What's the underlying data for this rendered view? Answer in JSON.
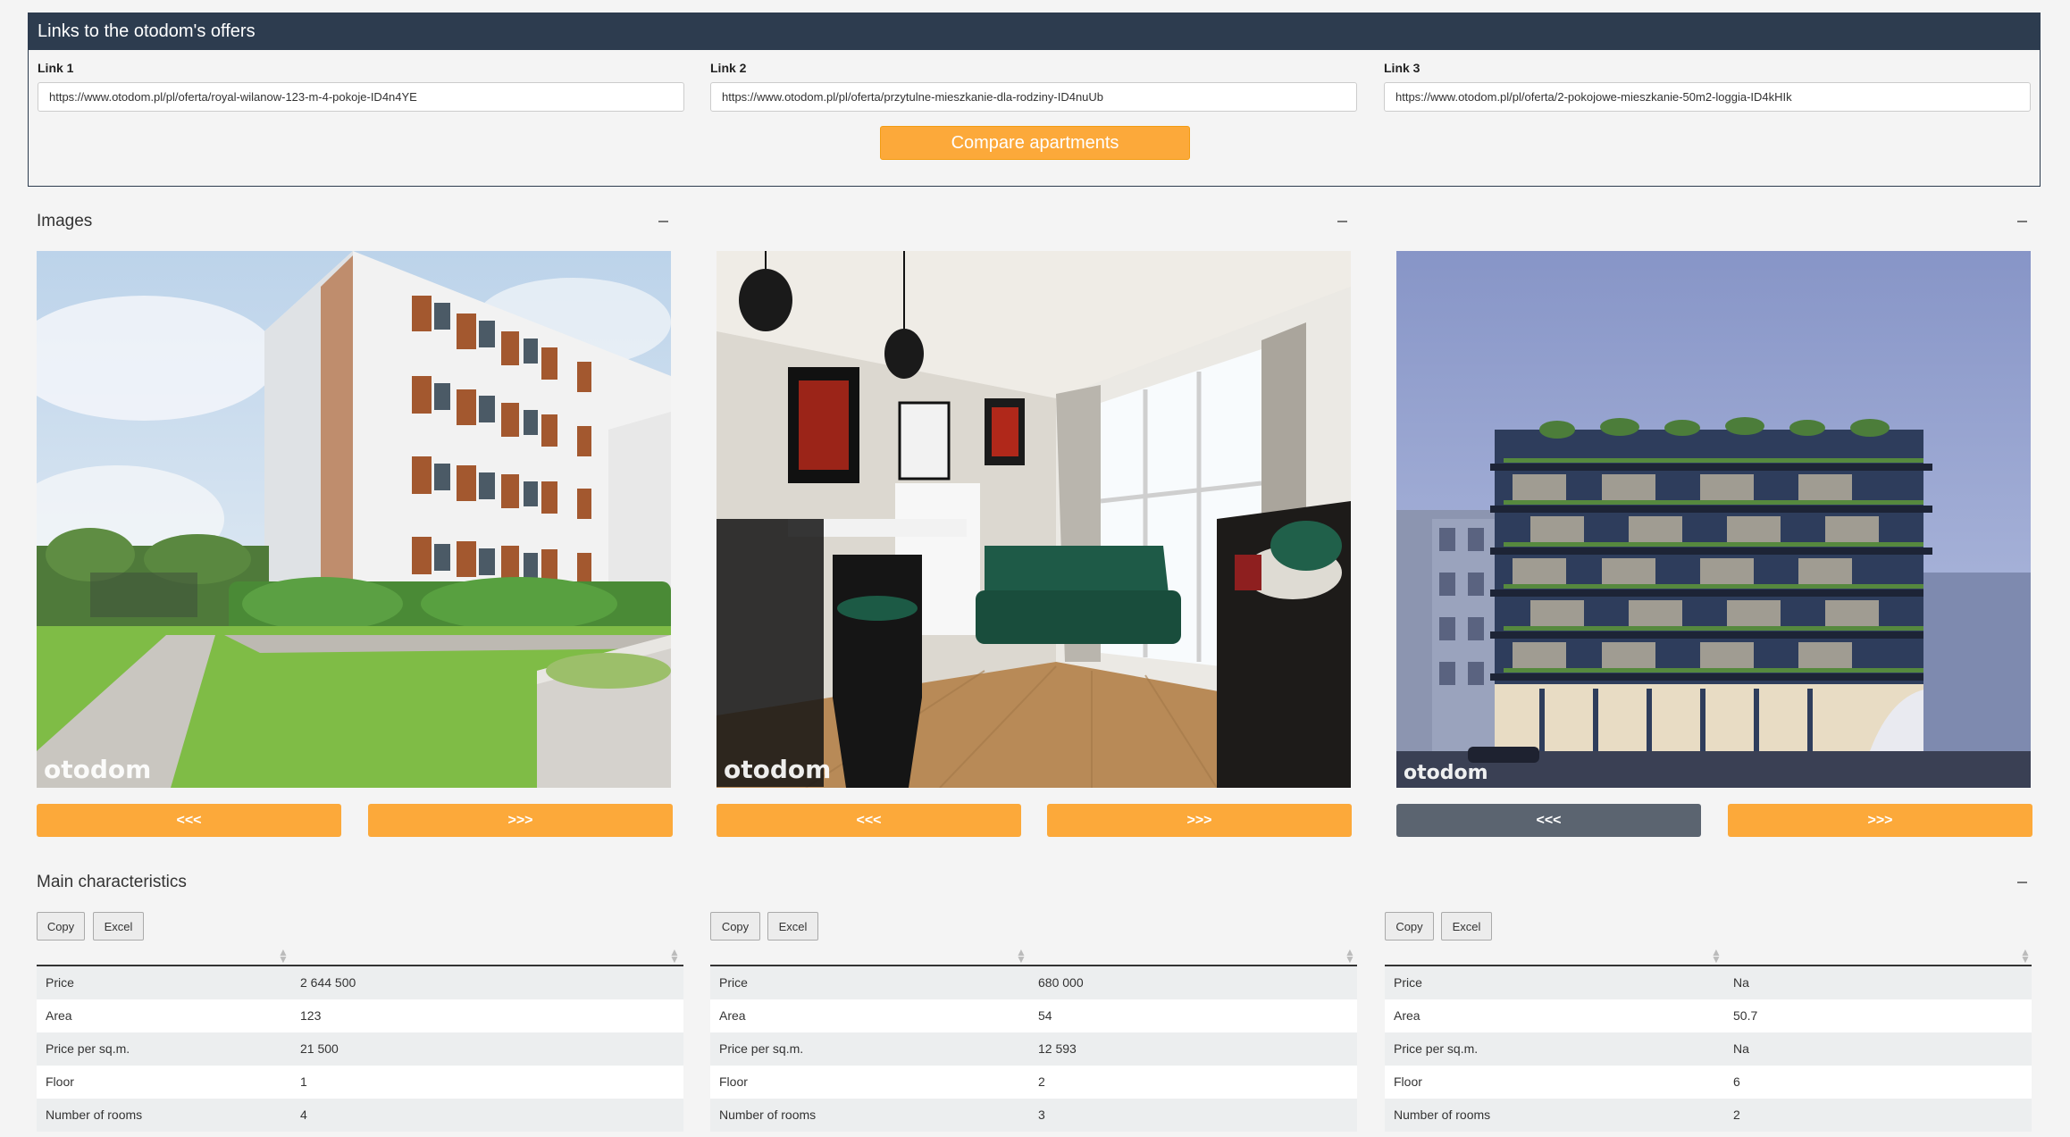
{
  "links_box": {
    "title": "Links to the otodom's offers",
    "links": [
      {
        "label": "Link 1",
        "value": "https://www.otodom.pl/pl/oferta/royal-wilanow-123-m-4-pokoje-ID4n4YE"
      },
      {
        "label": "Link 2",
        "value": "https://www.otodom.pl/pl/oferta/przytulne-mieszkanie-dla-rodziny-ID4nuUb"
      },
      {
        "label": "Link 3",
        "value": "https://www.otodom.pl/pl/oferta/2-pokojowe-mieszkanie-50m2-loggia-ID4kHIk"
      }
    ],
    "compare_label": "Compare apartments"
  },
  "images_section": {
    "title": "Images",
    "watermark": "otodom",
    "prev_label": "<<<",
    "next_label": ">>>"
  },
  "characteristics": {
    "title": "Main characteristics",
    "copy_label": "Copy",
    "excel_label": "Excel",
    "tables": [
      {
        "rows": [
          {
            "key": "Price",
            "value": "2 644 500"
          },
          {
            "key": "Area",
            "value": "123"
          },
          {
            "key": "Price per sq.m.",
            "value": "21 500"
          },
          {
            "key": "Floor",
            "value": "1"
          },
          {
            "key": "Number of rooms",
            "value": "4"
          }
        ]
      },
      {
        "rows": [
          {
            "key": "Price",
            "value": "680 000"
          },
          {
            "key": "Area",
            "value": "54"
          },
          {
            "key": "Price per sq.m.",
            "value": "12 593"
          },
          {
            "key": "Floor",
            "value": "2"
          },
          {
            "key": "Number of rooms",
            "value": "3"
          }
        ]
      },
      {
        "rows": [
          {
            "key": "Price",
            "value": "Na"
          },
          {
            "key": "Area",
            "value": "50.7"
          },
          {
            "key": "Price per sq.m.",
            "value": "Na"
          },
          {
            "key": "Floor",
            "value": "6"
          },
          {
            "key": "Number of rooms",
            "value": "2"
          }
        ]
      }
    ]
  },
  "colors": {
    "header_bg": "#2d3c4f",
    "accent_orange": "#fca93a",
    "disabled_button": "#5b6470"
  }
}
